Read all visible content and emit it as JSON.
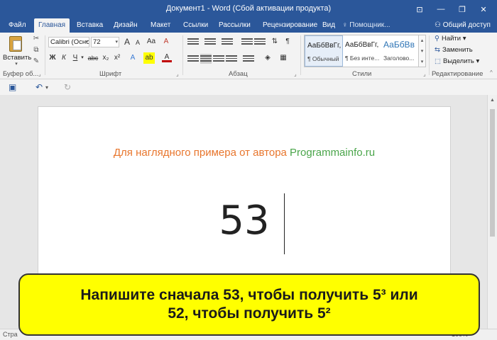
{
  "window": {
    "title": "Документ1 - Word (Сбой активации продукта)",
    "controls": {
      "ribbon_display": "⊡",
      "minimize": "—",
      "restore": "❐",
      "close": "✕"
    }
  },
  "tabs": [
    "Файл",
    "Главная",
    "Вставка",
    "Дизайн",
    "Макет",
    "Ссылки",
    "Рассылки",
    "Рецензирование",
    "Вид"
  ],
  "tell_me": "Помощник...",
  "share": "Общий доступ",
  "ribbon": {
    "clipboard": {
      "paste_label": "Вставить",
      "group_label": "Буфер об..."
    },
    "font": {
      "font_name": "Calibri (Осно",
      "font_size": "72",
      "bold": "Ж",
      "italic": "К",
      "underline": "Ч",
      "strike": "abc",
      "subscript": "x₂",
      "superscript": "x²",
      "grow": "A",
      "shrink": "A",
      "case": "Aa",
      "clear": "A",
      "effects": "A",
      "highlight": "ab",
      "color": "A",
      "group_label": "Шрифт"
    },
    "paragraph": {
      "group_label": "Абзац"
    },
    "styles": {
      "items": [
        {
          "sample": "АаБбВвГг,",
          "name": "¶ Обычный"
        },
        {
          "sample": "АаБбВвГг,",
          "name": "¶ Без инте..."
        },
        {
          "sample": "АаБбВв",
          "name": "Заголово..."
        }
      ],
      "group_label": "Стили"
    },
    "editing": {
      "find": "Найти",
      "replace": "Заменить",
      "select": "Выделить",
      "group_label": "Редактирование"
    }
  },
  "document": {
    "author_line_part1": "Для наглядного примера от автора ",
    "author_line_part2": "Programmainfo.ru",
    "content": "53"
  },
  "status": {
    "left": "Стра",
    "right": "100%"
  },
  "banner": {
    "line1": "Напишите сначала 53, чтобы получить 5³ или",
    "line2": "52, чтобы получить 5²"
  },
  "colors": {
    "accent": "#2b579a",
    "author_orange": "#e8762d",
    "author_green": "#4aa54a",
    "banner": "#ffff00"
  }
}
